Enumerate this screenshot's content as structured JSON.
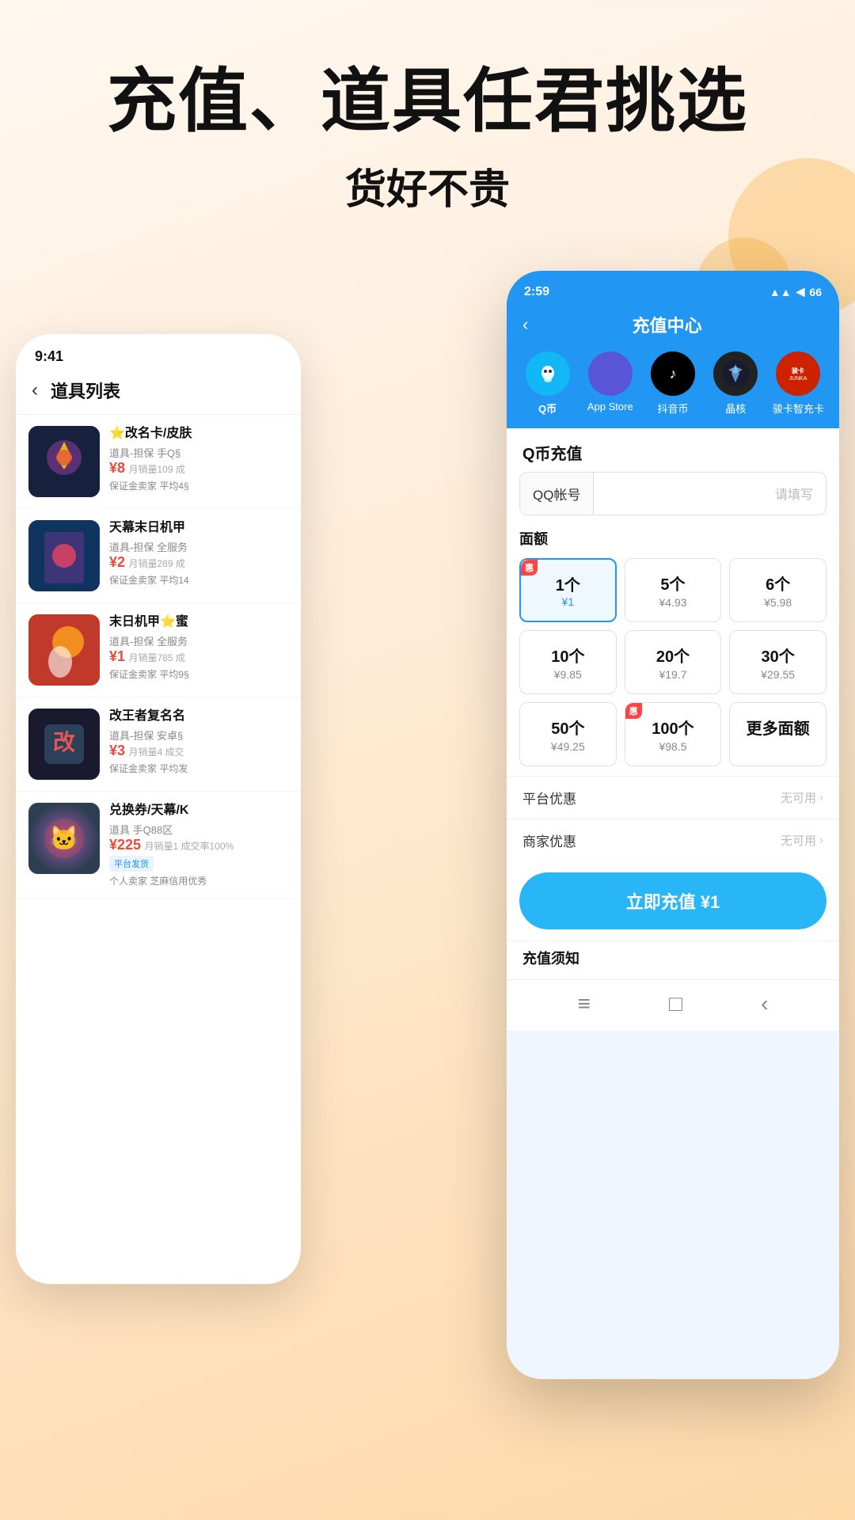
{
  "header": {
    "title": "充值、道具任君挑选",
    "subtitle": "货好不贵"
  },
  "left_phone": {
    "status_time": "9:41",
    "page_title": "道具列表",
    "back_label": "‹",
    "items": [
      {
        "name": "⭐改名卡/皮肤",
        "desc": "道具-担保 手Q§",
        "price": "¥8",
        "sales": "月销量109 成",
        "guarantee": "保证金卖家 平均4§",
        "img_class": "item-img-1"
      },
      {
        "name": "天幕末日机甲",
        "desc": "道具-担保 全服务",
        "price": "¥2",
        "sales": "月销量289 成",
        "guarantee": "保证金卖家 平均14",
        "img_class": "item-img-2"
      },
      {
        "name": "末日机甲⭐蜜",
        "desc": "道具-担保 全服务",
        "price": "¥1",
        "sales": "月销量785 成",
        "guarantee": "保证金卖家 平均9§",
        "img_class": "item-img-3"
      },
      {
        "name": "改王者复名名",
        "desc": "道具-担保 安卓§",
        "price": "¥3",
        "sales": "月销量4 成交",
        "guarantee": "保证金卖家 平均发",
        "img_class": "item-img-4"
      },
      {
        "name": "兑换券/天幕/K",
        "desc": "道具 手Q88区",
        "price": "¥225",
        "sales": "月销量1 成交率100%",
        "guarantee": "平台发货",
        "extra": "个人卖家 芝麻信用优秀",
        "img_class": "item-img-5",
        "badge": "平台发货"
      }
    ]
  },
  "right_phone": {
    "status_time": "2:59",
    "status_icons": "▲▲ ◀ 66",
    "header_title": "充值中心",
    "back_label": "‹",
    "tabs": [
      {
        "label": "Q币",
        "icon": "Q",
        "active": true
      },
      {
        "label": "App Store",
        "icon": "",
        "active": false
      },
      {
        "label": "抖音币",
        "icon": "♪",
        "active": false
      },
      {
        "label": "晶核",
        "icon": "★",
        "active": false
      },
      {
        "label": "骏卡智充卡",
        "icon": "骏卡",
        "active": false
      }
    ],
    "section_title": "Q币充值",
    "qq_label": "QQ帐号",
    "qq_placeholder": "请填写",
    "denomination_label": "面额",
    "denominations": [
      {
        "count": "1个",
        "price": "¥1",
        "selected": true,
        "hot": true
      },
      {
        "count": "5个",
        "price": "¥4.93",
        "selected": false,
        "hot": false
      },
      {
        "count": "6个",
        "price": "¥5.98",
        "selected": false,
        "hot": false
      },
      {
        "count": "10个",
        "price": "¥9.85",
        "selected": false,
        "hot": false
      },
      {
        "count": "20个",
        "price": "¥19.7",
        "selected": false,
        "hot": false
      },
      {
        "count": "30个",
        "price": "¥29.55",
        "selected": false,
        "hot": false
      },
      {
        "count": "50个",
        "price": "¥49.25",
        "selected": false,
        "hot": false
      },
      {
        "count": "100个",
        "price": "¥98.5",
        "selected": false,
        "hot": true
      },
      {
        "count": "更多面额",
        "price": "",
        "selected": false,
        "hot": false
      }
    ],
    "platform_discount": "平台优惠",
    "platform_discount_value": "无可用",
    "merchant_discount": "商家优惠",
    "merchant_discount_value": "无可用",
    "recharge_button": "立即充值 ¥1",
    "notice_title": "充值须知",
    "bottom_nav": [
      "≡",
      "□",
      "‹"
    ]
  }
}
